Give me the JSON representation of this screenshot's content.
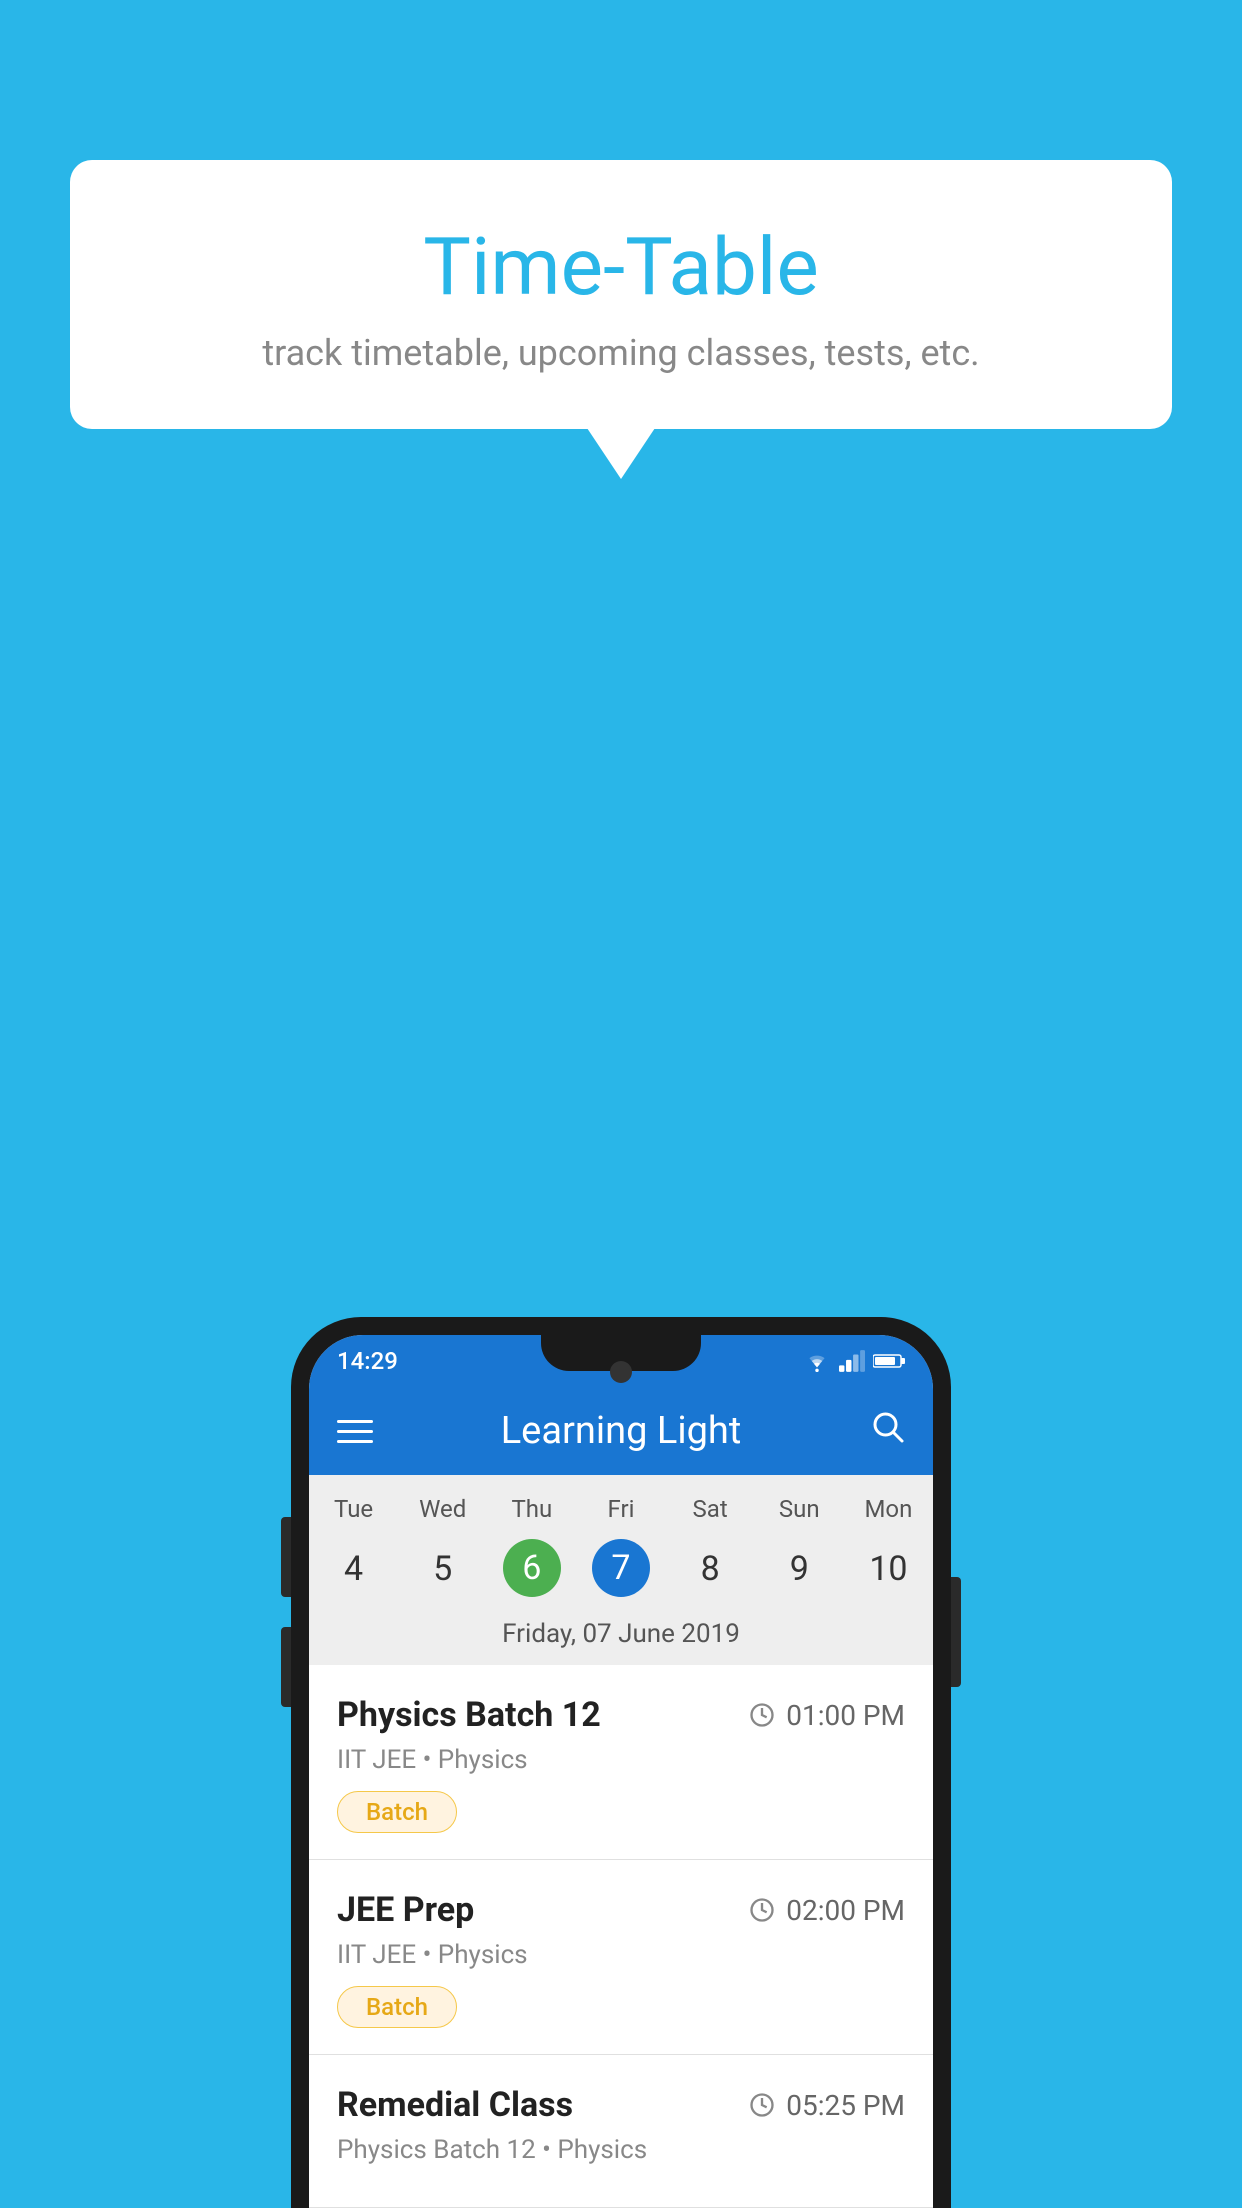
{
  "background_color": "#29b6e8",
  "speech_bubble": {
    "title": "Time-Table",
    "subtitle": "track timetable, upcoming classes, tests, etc."
  },
  "phone": {
    "status_bar": {
      "time": "14:29",
      "icons": [
        "wifi",
        "signal",
        "battery"
      ]
    },
    "app_bar": {
      "title": "Learning Light",
      "menu_label": "Menu",
      "search_label": "Search"
    },
    "calendar": {
      "days": [
        {
          "label": "Tue",
          "number": "4"
        },
        {
          "label": "Wed",
          "number": "5"
        },
        {
          "label": "Thu",
          "number": "6",
          "state": "today"
        },
        {
          "label": "Fri",
          "number": "7",
          "state": "selected"
        },
        {
          "label": "Sat",
          "number": "8"
        },
        {
          "label": "Sun",
          "number": "9"
        },
        {
          "label": "Mon",
          "number": "10"
        }
      ],
      "selected_date_label": "Friday, 07 June 2019"
    },
    "schedule": [
      {
        "title": "Physics Batch 12",
        "time": "01:00 PM",
        "sub": "IIT JEE • Physics",
        "badge": "Batch"
      },
      {
        "title": "JEE Prep",
        "time": "02:00 PM",
        "sub": "IIT JEE • Physics",
        "badge": "Batch"
      },
      {
        "title": "Remedial Class",
        "time": "05:25 PM",
        "sub": "Physics Batch 12 • Physics",
        "badge": ""
      }
    ]
  }
}
